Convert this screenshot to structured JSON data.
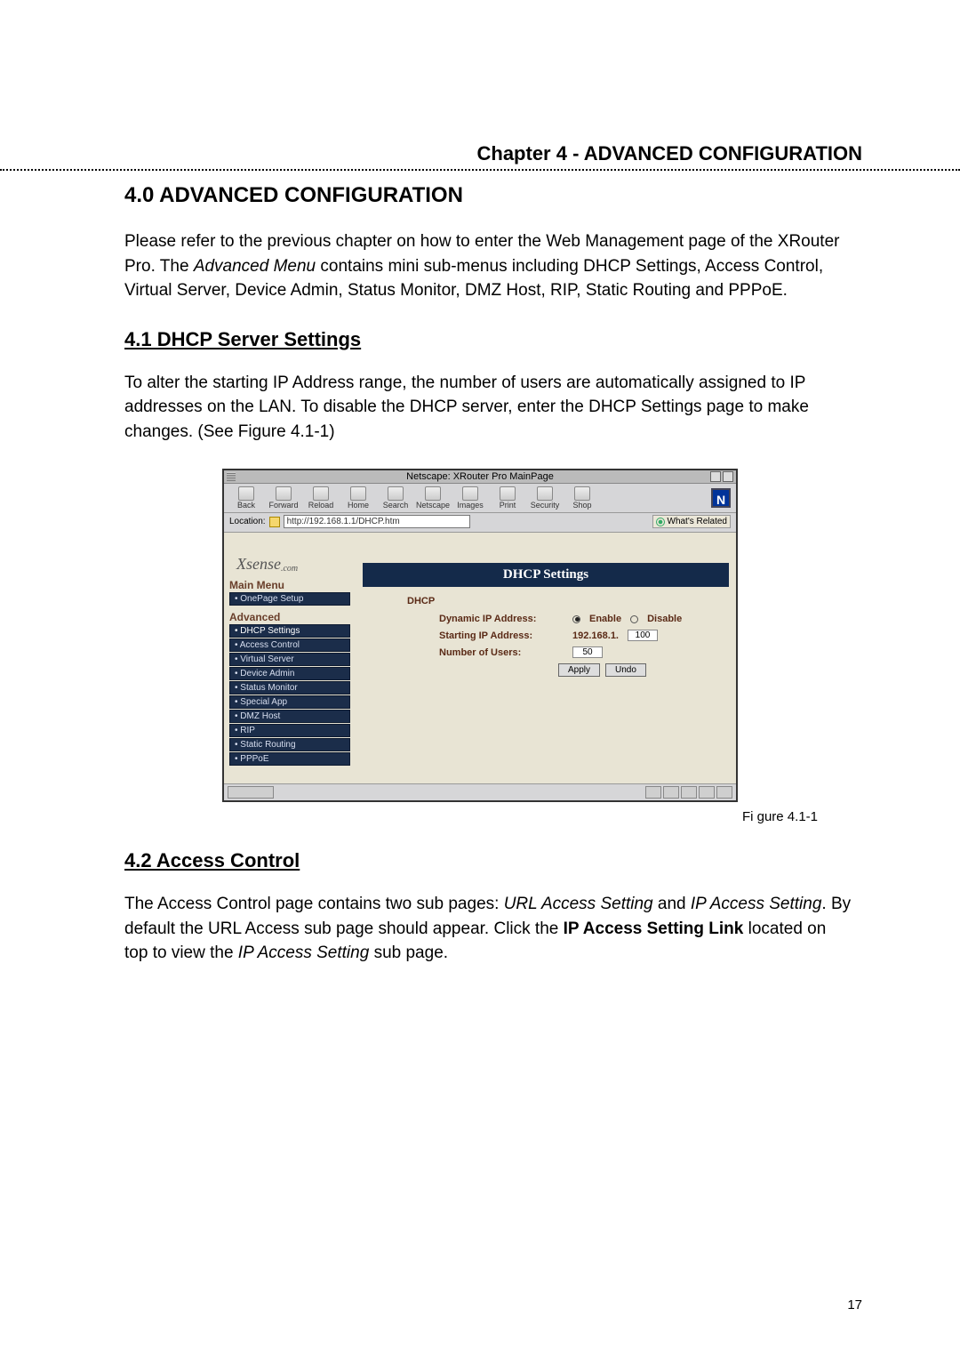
{
  "chapter_header": "Chapter 4 - ADVANCED CONFIGURATION",
  "main_heading": "4.0  ADVANCED CONFIGURATION",
  "intro_text": "Please refer to the previous chapter on how to enter the Web Management page of the XRouter Pro. The ",
  "intro_italic": "Advanced Menu",
  "intro_text2": " contains mini sub-menus including DHCP Settings, Access Control, Virtual Server, Device Admin,  Status Monitor, DMZ Host, RIP, Static Routing and PPPoE.",
  "section_4_1": "4.1  DHCP Server Settings",
  "p_4_1": "To alter the starting IP Address range, the number of users are automatically assigned to IP addresses on the LAN.  To disable the DHCP server, enter the DHCP Settings page to make changes. (See Figure 4.1-1)",
  "figure_caption": "Fi gure 4.1-1",
  "section_4_2": "4.2  Access Control",
  "p_4_2_a": "The Access Control page contains two sub pages: ",
  "p_4_2_italic1": "URL Access Setting",
  "p_4_2_b": " and ",
  "p_4_2_italic2": "IP Access Setting",
  "p_4_2_c": ".  By default the URL Access sub page should appear.  Click the ",
  "p_4_2_bold": "IP Access Setting Link",
  "p_4_2_d": " located on top to view the ",
  "p_4_2_italic3": "IP Access Setting",
  "p_4_2_e": " sub page.",
  "page_number": "17",
  "screenshot": {
    "window_title": "Netscape: XRouter Pro MainPage",
    "toolbar": {
      "back": "Back",
      "forward": "Forward",
      "reload": "Reload",
      "home": "Home",
      "search": "Search",
      "netscape": "Netscape",
      "images": "Images",
      "print": "Print",
      "security": "Security",
      "shop": "Shop",
      "n_badge": "N"
    },
    "location_label": "Location:",
    "url": "http://192.168.1.1/DHCP.htm",
    "whats_related": "What's Related",
    "logo": "Xsense",
    "logo_sub": ".com",
    "main_menu_label": "Main Menu",
    "menu_onepage": "OnePage Setup",
    "advanced_label": "Advanced",
    "menu_items": [
      "DHCP Settings",
      "Access Control",
      "Virtual Server",
      "Device Admin",
      "Status Monitor",
      "Special App",
      "DMZ Host",
      "RIP",
      "Static Routing",
      "PPPoE"
    ],
    "panel_title": "DHCP Settings",
    "form_heading": "DHCP",
    "row1_label": "Dynamic IP Address:",
    "row1_enable": "Enable",
    "row1_disable": "Disable",
    "row2_label": "Starting IP Address:",
    "row2_prefix": "192.168.1.",
    "row2_value": "100",
    "row3_label": "Number of Users:",
    "row3_value": "50",
    "apply_btn": "Apply",
    "undo_btn": "Undo"
  }
}
